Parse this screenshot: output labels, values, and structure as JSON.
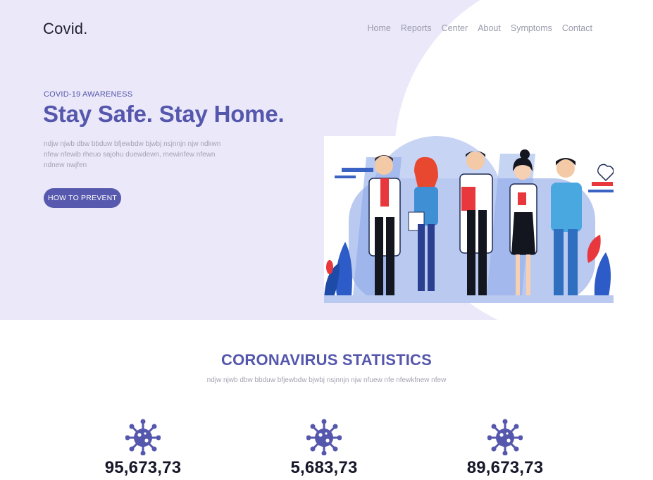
{
  "header": {
    "logo": "Covid.",
    "nav": [
      "Home",
      "Reports",
      "Center",
      "About",
      "Symptoms",
      "Contact"
    ]
  },
  "hero": {
    "eyebrow": "COVID-19 AWARENESS",
    "title": "Stay Safe. Stay Home.",
    "text": "ndjw njwb dbw bbduw bfjewbdw bjwbj nsjnnjn njw ndkwn nfew nfewib rheuo sajohu duewdewn, mewinfew nfewn ndnew nwjfen",
    "cta": "HOW TO PREVENT",
    "illustration_icon": "medical-staff-illustration"
  },
  "stats": {
    "title": "CORONAVIRUS STATISTICS",
    "subtitle": "ndjw njwb dbw bbduw bfjewbdw bjwbj nsjnnjn njw nfuew nfe nfewkfnew nfew",
    "items": [
      {
        "icon": "virus-icon",
        "value": "95,673,73"
      },
      {
        "icon": "virus-icon",
        "value": "5,683,73"
      },
      {
        "icon": "virus-icon",
        "value": "89,673,73"
      }
    ]
  },
  "colors": {
    "accent": "#5557ad",
    "hero_bg": "#ebe8fa",
    "muted": "#a3a3b3"
  }
}
